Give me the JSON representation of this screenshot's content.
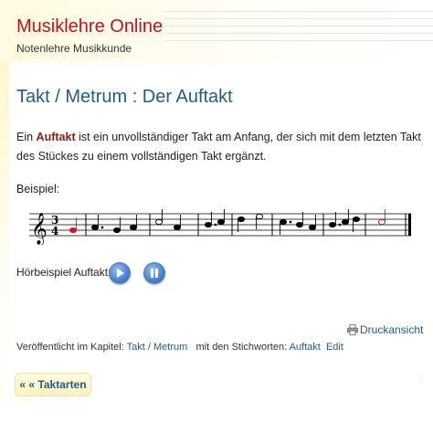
{
  "site": {
    "title": "Musiklehre Online",
    "subtitle": "Notenlehre Musikkunde"
  },
  "article": {
    "title": "Takt / Metrum : Der Auftakt",
    "intro_prefix": "Ein ",
    "intro_keyword": "Auftakt",
    "intro_rest": " ist ein unvollständiger Takt am Anfang, der sich mit dem letzten Takt des Stückes zu einem vollständigen Takt ergänzt.",
    "example_label": "Beispiel:",
    "time_signature": {
      "top": "3",
      "bottom": "4"
    },
    "audio_label": "Hörbeispiel Auftakt:",
    "accent_color": "#d9141b"
  },
  "toolbar": {
    "print_label": "Druckansicht"
  },
  "meta": {
    "published_in": "Veröffentlicht im Kapitel:",
    "chapter_link": "Takt / Metrum",
    "keywords_label": "mit den Stichworten:",
    "keyword_link": "Auftakt",
    "edit_link": "Edit"
  },
  "navigation": {
    "prev_label": "« « Taktarten"
  },
  "icons": {
    "play": "play-icon",
    "pause": "pause-icon",
    "print": "printer-icon",
    "clef": "treble-clef-icon"
  }
}
